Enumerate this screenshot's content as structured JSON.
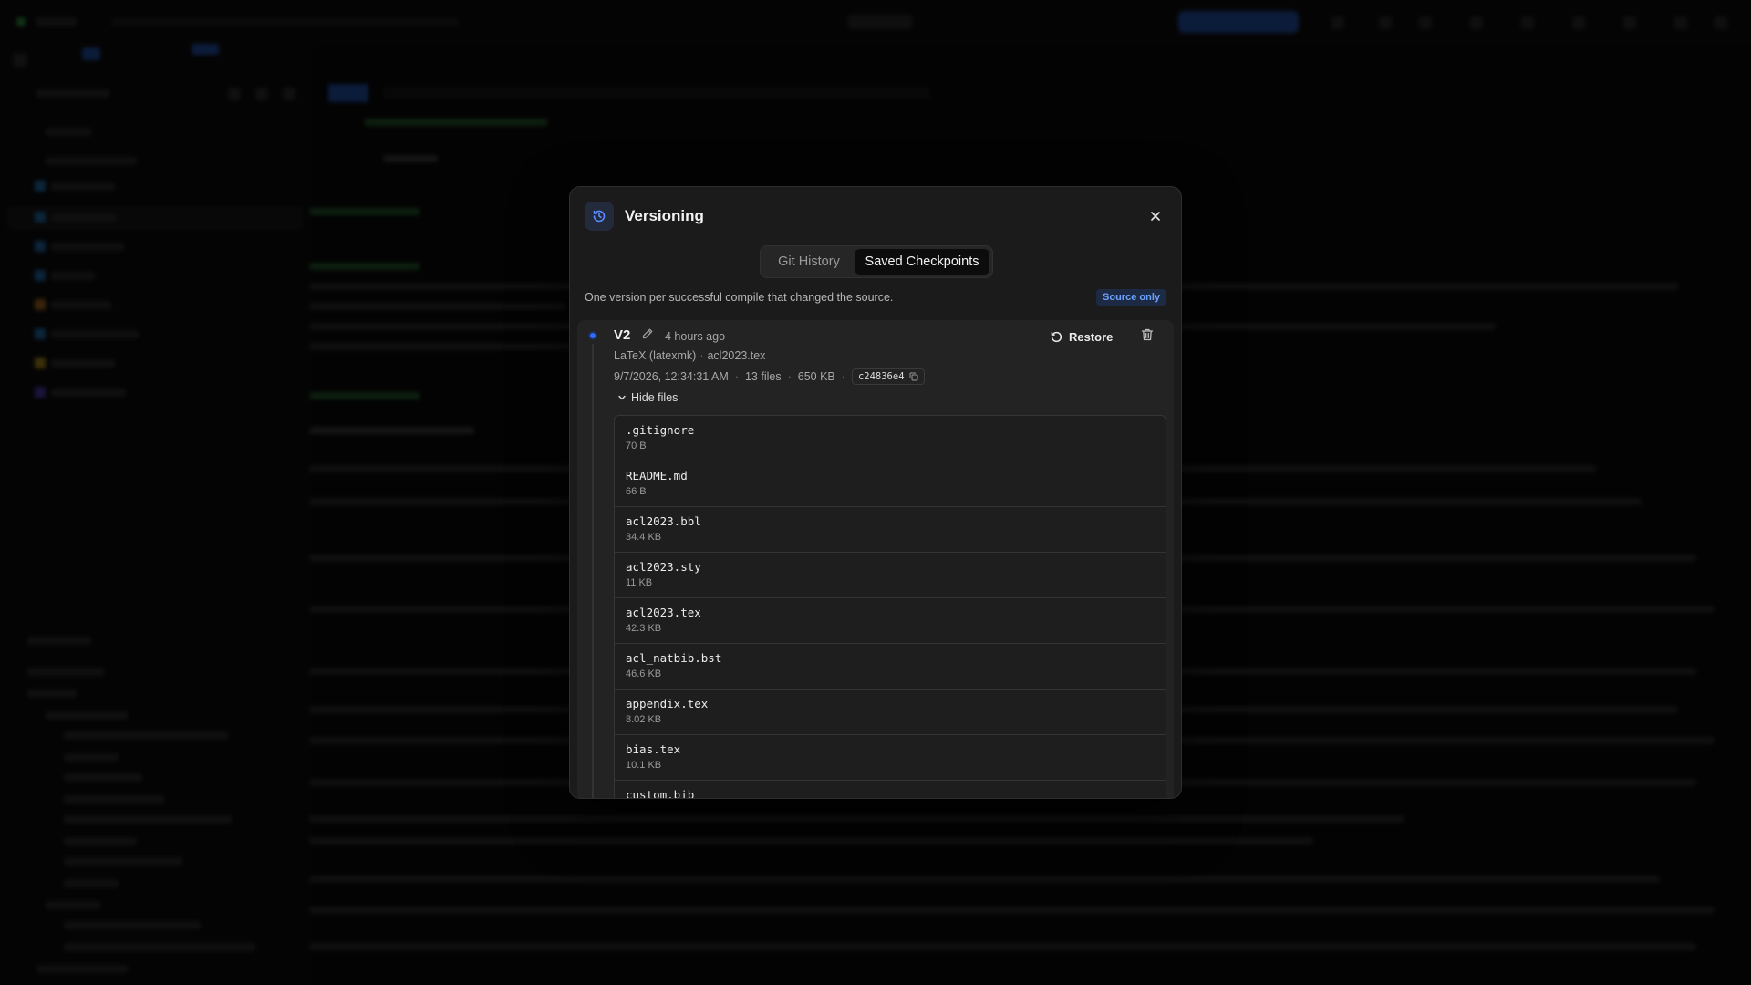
{
  "modal": {
    "title": "Versioning",
    "tabs": [
      {
        "label": "Git History",
        "active": false
      },
      {
        "label": "Saved Checkpoints",
        "active": true
      }
    ],
    "subtitle": "One version per successful compile that changed the source.",
    "source_badge": "Source only",
    "accent_color": "#2f6bff"
  },
  "version": {
    "name": "V2",
    "relative_time": "4 hours ago",
    "restore_label": "Restore",
    "engine": "LaTeX (latexmk)",
    "main_file": "acl2023.tex",
    "timestamp": "9/7/2026, 12:34:31 AM",
    "file_count": "13 files",
    "size": "650 KB",
    "hash": "c24836e4",
    "toggle_label": "Hide files",
    "files": [
      {
        "name": ".gitignore",
        "size": "70 B"
      },
      {
        "name": "README.md",
        "size": "66 B"
      },
      {
        "name": "acl2023.bbl",
        "size": "34.4 KB"
      },
      {
        "name": "acl2023.sty",
        "size": "11 KB"
      },
      {
        "name": "acl2023.tex",
        "size": "42.3 KB"
      },
      {
        "name": "acl_natbib.bst",
        "size": "46.6 KB"
      },
      {
        "name": "appendix.tex",
        "size": "8.02 KB"
      },
      {
        "name": "bias.tex",
        "size": "10.1 KB"
      },
      {
        "name": "custom.bib",
        "size": ""
      }
    ]
  },
  "icons": [
    "history-icon",
    "close-icon",
    "pencil-icon",
    "restore-icon",
    "trash-icon",
    "copy-icon",
    "chevron-down-icon"
  ]
}
